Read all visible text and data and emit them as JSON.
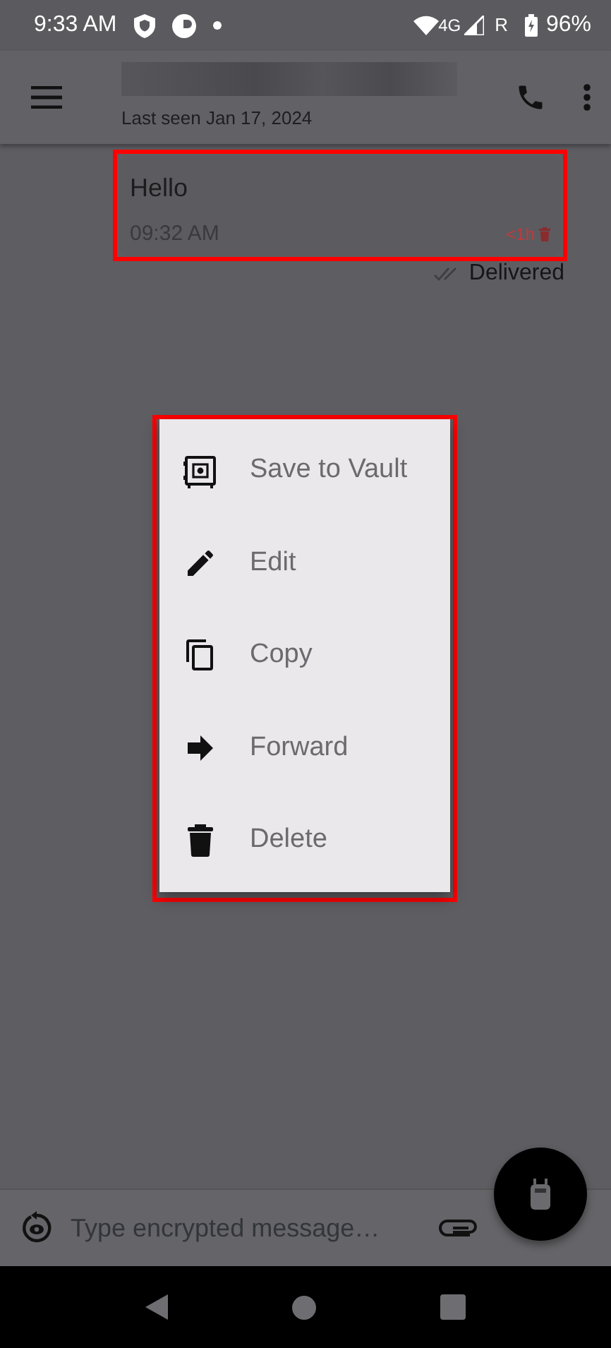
{
  "status_bar": {
    "time": "9:33 AM",
    "network": "4G",
    "roaming": "R",
    "battery": "96%"
  },
  "chat_header": {
    "subtitle": "Last seen Jan 17, 2024"
  },
  "message": {
    "text": "Hello",
    "time": "09:32 AM",
    "expiry": "<1h",
    "status": "Delivered"
  },
  "context_menu": [
    {
      "label": "Save to Vault",
      "kind": "vault"
    },
    {
      "label": "Edit",
      "kind": "edit"
    },
    {
      "label": "Copy",
      "kind": "copy"
    },
    {
      "label": "Forward",
      "kind": "forward"
    },
    {
      "label": "Delete",
      "kind": "delete"
    }
  ],
  "composer": {
    "placeholder": "Type encrypted message…"
  }
}
